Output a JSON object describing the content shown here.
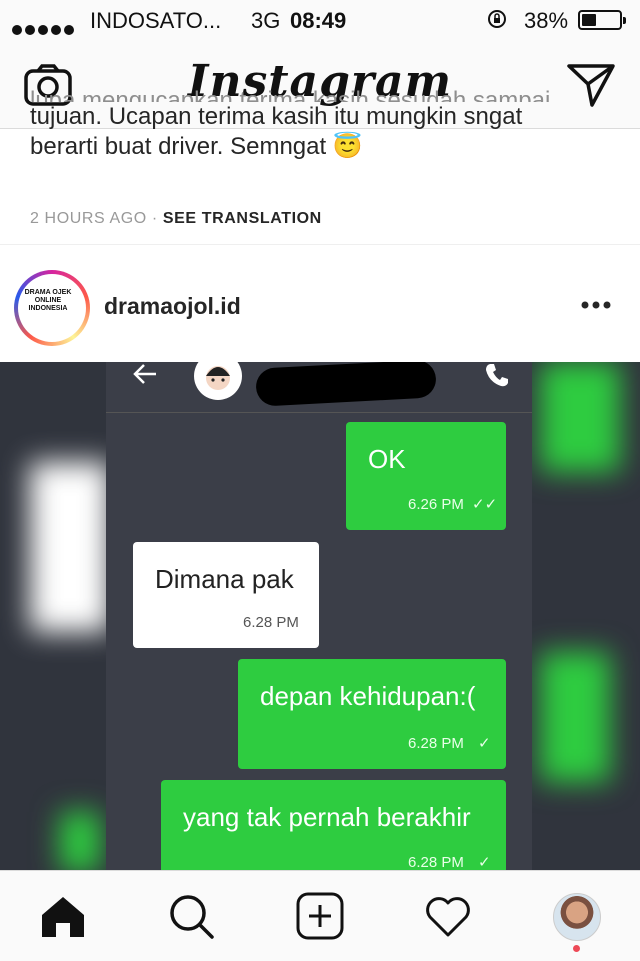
{
  "status_bar": {
    "carrier": "INDOSATO...",
    "network": "3G",
    "time": "08:49",
    "battery_percent": "38%",
    "battery_level": 0.38,
    "icons": [
      "signal-dots-icon",
      "rotation-lock-icon",
      "battery-icon"
    ]
  },
  "nav": {
    "title": "Instagram",
    "left_icon": "camera-icon",
    "right_icon": "direct-message-icon"
  },
  "previous_post": {
    "caption_cut": "lupa mengucapkan terima kasih sesudah sampai",
    "caption_line2": "tujuan. Ucapan terima kasih itu mungkin sngat",
    "caption_line3": "berarti buat driver. Semngat 😇",
    "time_ago": "2 HOURS AGO",
    "separator": "·",
    "see_translation": "SEE TRANSLATION"
  },
  "post": {
    "username": "dramaojol.id",
    "avatar_text": "DRAMA OJEK ONLINE INDONESIA",
    "more_icon": "more-options-icon",
    "chat": {
      "messages": [
        {
          "side": "sent",
          "text": "OK",
          "time": "6.26 PM",
          "status": "✓✓"
        },
        {
          "side": "received",
          "text": "Dimana pak",
          "time": "6.28 PM",
          "status": ""
        },
        {
          "side": "sent",
          "text": "depan kehidupan:(",
          "time": "6.28 PM",
          "status": "✓"
        },
        {
          "side": "sent",
          "text": "yang tak pernah berakhir",
          "time": "6.28 PM",
          "status": "✓"
        }
      ]
    }
  },
  "tabbar": {
    "items": [
      {
        "name": "home-icon",
        "active": true
      },
      {
        "name": "search-icon",
        "active": false
      },
      {
        "name": "add-post-icon",
        "active": false
      },
      {
        "name": "activity-heart-icon",
        "active": false
      },
      {
        "name": "profile-avatar",
        "active": false
      }
    ],
    "notification_color": "#ed4956"
  },
  "colors": {
    "bubble_green": "#2ecc40",
    "chat_bg": "#3b3e48"
  }
}
